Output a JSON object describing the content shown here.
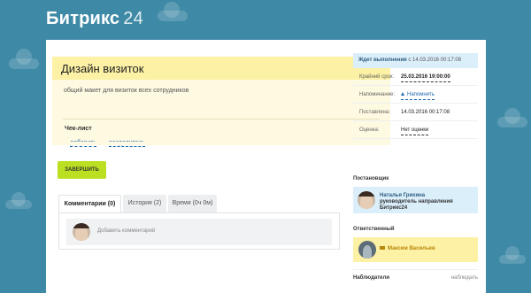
{
  "header": {
    "brand": "Битрикс",
    "brand_num": "24"
  },
  "task": {
    "title": "Дизайн визиток",
    "description": "общий макет для визиток всех сотрудников",
    "checklist_title": "Чек-лист",
    "checklist_add": "добавить",
    "checklist_separator": "разделитель"
  },
  "actions": {
    "finish": "ЗАВЕРШИТЬ"
  },
  "tabs": [
    {
      "label": "Комментарии (0)"
    },
    {
      "label": "История (2)"
    },
    {
      "label": "Время (0ч 0м)"
    }
  ],
  "comment": {
    "placeholder": "Добавить комментарий"
  },
  "sidebar": {
    "status": "Ждет выполнения",
    "status_since": "с 14.03.2016 00:17:08",
    "props": [
      {
        "label": "Крайний срок:",
        "value": "25.03.2016 19:00:00"
      },
      {
        "label": "Напоминание:",
        "value": "Напомнить"
      },
      {
        "label": "Поставлена:",
        "value": "14.03.2016 00:17:08"
      },
      {
        "label": "Оценка:",
        "value": "Нет оценки"
      }
    ],
    "creator_title": "Постановщик",
    "creator_name": "Наталья Грихина",
    "creator_role": "руководитель направления Битрикс24",
    "responsible_title": "Ответственный",
    "responsible_name": "Максим Васильев",
    "watchers_title": "Наблюдатели",
    "watchers_action": "наблюдать"
  },
  "colors": {
    "background": "#3e8aa6",
    "accent_green": "#bbe022",
    "task_yellow": "#fcf1a4",
    "info_blue": "#dbeffb"
  }
}
